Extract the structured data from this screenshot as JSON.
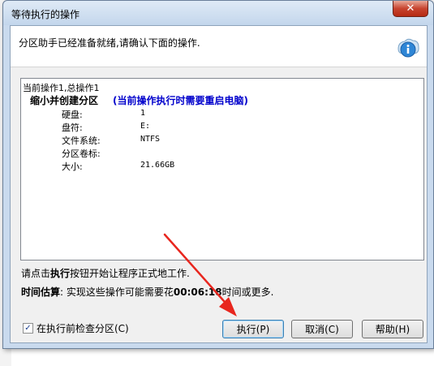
{
  "window": {
    "title": "等待执行的操作",
    "close_label": "✕"
  },
  "header": {
    "text": "分区助手已经准备就绪,请确认下面的操作.",
    "icon": "info-icon"
  },
  "report": {
    "summary": "当前操作1,总操作1",
    "operation": "缩小并创建分区",
    "warning": "(当前操作执行时需要重启电脑)",
    "rows": [
      {
        "label": "硬盘:",
        "value": "1"
      },
      {
        "label": "盘符:",
        "value": "E:"
      },
      {
        "label": "文件系统:",
        "value": "NTFS"
      },
      {
        "label": "分区卷标:",
        "value": ""
      },
      {
        "label": "大小:",
        "value": "21.66GB"
      }
    ]
  },
  "hint": {
    "prefix": "请点击",
    "keyword": "执行",
    "suffix": "按钮开始让程序正式地工作."
  },
  "estimate": {
    "label": "时间估算",
    "text": ": 实现这些操作可能需要花",
    "time": "00:06:18",
    "suffix": "时间或更多."
  },
  "checkbox": {
    "label": "在执行前检查分区(C)",
    "checked": true
  },
  "buttons": {
    "execute": "执行(P)",
    "cancel": "取消(C)",
    "help": "帮助(H)"
  },
  "colors": {
    "warning": "#0000cc",
    "arrow": "#e8261e"
  }
}
